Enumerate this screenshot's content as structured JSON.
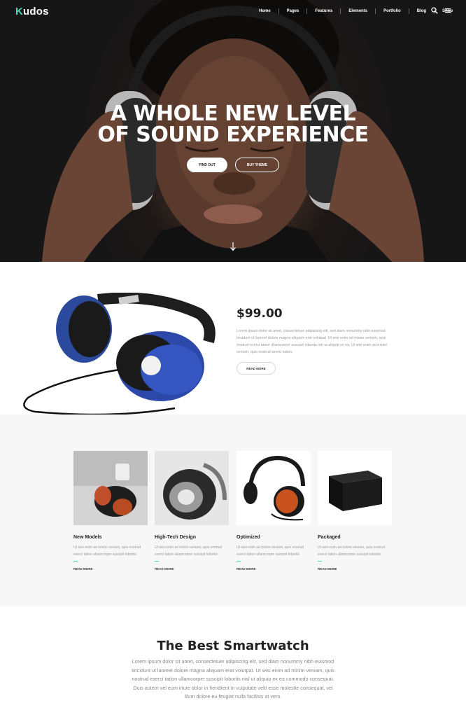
{
  "brand": {
    "logo_first": "K",
    "logo_rest": "udos",
    "accent": "#48d6b5"
  },
  "nav": {
    "items": [
      "Home",
      "Pages",
      "Features",
      "Elements",
      "Portfolio",
      "Blog",
      "Shop"
    ],
    "icons": [
      "search-icon",
      "menu-icon"
    ]
  },
  "hero": {
    "title_line1": "A WHOLE NEW LEVEL",
    "title_line2": "OF SOUND EXPERIENCE",
    "btn_primary": "FIND OUT",
    "btn_secondary": "BUY THEME",
    "scroll_icon": "arrow-down-icon"
  },
  "product": {
    "price": "$99.00",
    "description": "Lorem ipsum dolor sit amet, consectetuer adipiscing elit, sed diam nonummy nibh euismod tincidunt ut laoreet dolore magna aliquam erat volutpat. Ut wisi enim ad minim veniam, quis nostrud exerci tation ullamcorper suscipit lobortis nisl ut aliquip ex ea. Ut wisi enim ad minim veniam, quis nostrud exerci tation.",
    "button": "READ MORE"
  },
  "features": [
    {
      "title": "New Models",
      "text": "Ut wisi enim ad minim veniam, quis nostrud exerci tation ullamcorper suscipit lobortis",
      "link": "READ MORE"
    },
    {
      "title": "High-Tech Design",
      "text": "Ut wisi enim ad minim veniam, quis nostrud exerci tation ullamcorper suscipit lobortis",
      "link": "READ MORE"
    },
    {
      "title": "Optimized",
      "text": "Ut wisi enim ad minim veniam, quis nostrud exerci tation ullamcorper suscipit lobortis",
      "link": "READ MORE"
    },
    {
      "title": "Packaged",
      "text": "Ut wisi enim ad minim veniam, quis nostrud exerci tation ullamcorper suscipit lobortis",
      "link": "READ MORE"
    }
  ],
  "smartwatch": {
    "title": "The Best Smartwatch",
    "text": "Lorem ipsum dolor sit amet, consectetuer adipiscing elit, sed diam nonummy nibh euismod tincidunt ut laoreet dolore magna aliquam erat volutpat. Ut wisi enim ad minim veniam, quis nostrud exerci tation ullamcorper suscipit lobortis nisl ut aliquip ex ea commodo consequat. Duis autem vel eum iriure dolor in hendrerit in vulputate velit esse molestie consequat, vel illum dolore eu feugiat nulla facilisis at vero."
  }
}
